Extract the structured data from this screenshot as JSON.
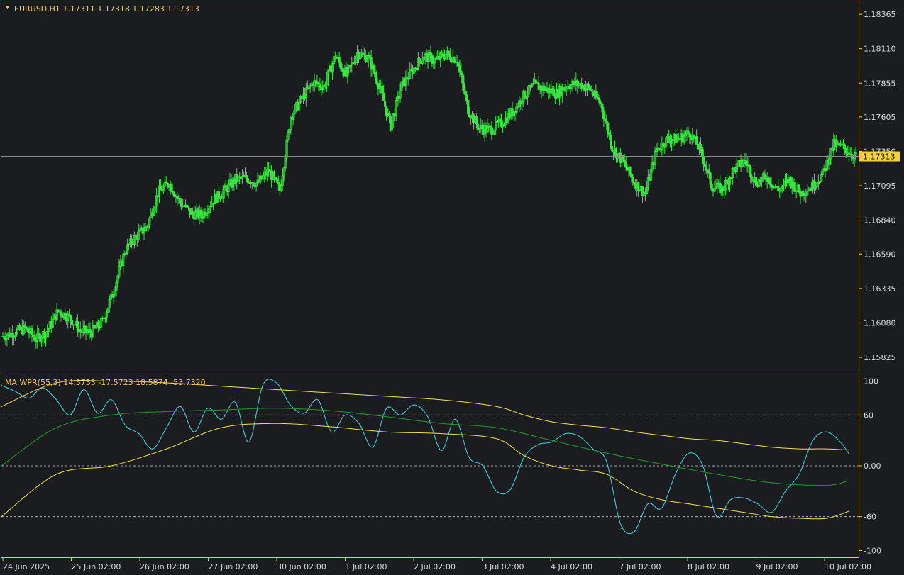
{
  "colors": {
    "background": "#1b1c20",
    "frame": "#f2c94c",
    "bull_candle": "#37e63f",
    "bear_candle": "#37e63f",
    "price_line": "#8a8a8a",
    "price_tag_bg": "#f2d13a",
    "wpr_line": "#3fd8e6",
    "band_line": "#f2e04a",
    "mid_line": "#1e9c2a",
    "text": "#d8d8d8",
    "header_text": "#f2c94c"
  },
  "chart_data": [
    {
      "type": "candlestick",
      "title": "EURUSD,H1  1.17311 1.17318 1.17283 1.17313",
      "symbol": "EURUSD,H1",
      "ohlc": {
        "open": 1.17311,
        "high": 1.17318,
        "low": 1.17283,
        "close": 1.17313
      },
      "current_price": 1.17313,
      "current_price_label": "1.17313",
      "ylim": [
        1.1572,
        1.1846
      ],
      "yticks": [
        1.18365,
        1.1811,
        1.17855,
        1.17605,
        1.1735,
        1.17095,
        1.1684,
        1.1659,
        1.16335,
        1.1608,
        1.15825
      ],
      "ytick_labels": [
        "1.18365",
        "1.18110",
        "1.17855",
        "1.17605",
        "1.17350",
        "1.17095",
        "1.16840",
        "1.16590",
        "1.16335",
        "1.16080",
        "1.15825"
      ],
      "xtick_labels": [
        "24 Jun 2025",
        "25 Jun 02:00",
        "26 Jun 02:00",
        "27 Jun 02:00",
        "30 Jun 02:00",
        "1 Jul 02:00",
        "2 Jul 02:00",
        "3 Jul 02:00",
        "4 Jul 02:00",
        "7 Jul 02:00",
        "8 Jul 02:00",
        "9 Jul 02:00",
        "10 Jul 02:00"
      ],
      "close_path": [
        [
          0,
          1.1598
        ],
        [
          8,
          1.1601
        ],
        [
          16,
          1.1604
        ],
        [
          24,
          1.1596
        ],
        [
          32,
          1.1602
        ],
        [
          40,
          1.1617
        ],
        [
          48,
          1.1612
        ],
        [
          56,
          1.1602
        ],
        [
          64,
          1.1601
        ],
        [
          72,
          1.1609
        ],
        [
          80,
          1.1632
        ],
        [
          88,
          1.1661
        ],
        [
          96,
          1.1672
        ],
        [
          104,
          1.1679
        ],
        [
          112,
          1.1704
        ],
        [
          120,
          1.1712
        ],
        [
          128,
          1.1697
        ],
        [
          136,
          1.1689
        ],
        [
          144,
          1.1688
        ],
        [
          152,
          1.1699
        ],
        [
          160,
          1.1706
        ],
        [
          168,
          1.1714
        ],
        [
          176,
          1.1715
        ],
        [
          184,
          1.1711
        ],
        [
          192,
          1.1721
        ],
        [
          200,
          1.1706
        ],
        [
          208,
          1.1761
        ],
        [
          216,
          1.1774
        ],
        [
          224,
          1.1786
        ],
        [
          232,
          1.1783
        ],
        [
          240,
          1.1806
        ],
        [
          248,
          1.1791
        ],
        [
          256,
          1.1808
        ],
        [
          264,
          1.1804
        ],
        [
          272,
          1.1783
        ],
        [
          280,
          1.1754
        ],
        [
          288,
          1.1784
        ],
        [
          296,
          1.1795
        ],
        [
          304,
          1.1806
        ],
        [
          312,
          1.1802
        ],
        [
          320,
          1.1807
        ],
        [
          328,
          1.1803
        ],
        [
          336,
          1.1766
        ],
        [
          344,
          1.1752
        ],
        [
          352,
          1.1751
        ],
        [
          360,
          1.1756
        ],
        [
          368,
          1.1764
        ],
        [
          376,
          1.1776
        ],
        [
          384,
          1.1784
        ],
        [
          392,
          1.1781
        ],
        [
          400,
          1.1778
        ],
        [
          408,
          1.1784
        ],
        [
          416,
          1.1785
        ],
        [
          424,
          1.1781
        ],
        [
          432,
          1.177
        ],
        [
          440,
          1.1738
        ],
        [
          448,
          1.1727
        ],
        [
          456,
          1.1712
        ],
        [
          464,
          1.1704
        ],
        [
          472,
          1.1736
        ],
        [
          480,
          1.1744
        ],
        [
          488,
          1.1744
        ],
        [
          496,
          1.1749
        ],
        [
          504,
          1.1735
        ],
        [
          512,
          1.1709
        ],
        [
          520,
          1.1707
        ],
        [
          528,
          1.1722
        ],
        [
          536,
          1.1728
        ],
        [
          544,
          1.1712
        ],
        [
          552,
          1.1716
        ],
        [
          560,
          1.1706
        ],
        [
          568,
          1.1714
        ],
        [
          576,
          1.1704
        ],
        [
          584,
          1.1709
        ],
        [
          592,
          1.1718
        ],
        [
          600,
          1.174
        ],
        [
          608,
          1.1737
        ],
        [
          616,
          1.1731
        ]
      ]
    },
    {
      "type": "line",
      "title": "MA  WPR(55,3) 14.5733 -17.5723 18.5874 -53.7320",
      "indicator": "WPR(55,3)",
      "values": [
        14.5733,
        -17.5723,
        18.5874,
        -53.732
      ],
      "ylim": [
        -108,
        108
      ],
      "yticks": [
        100,
        60,
        0,
        -60,
        -100
      ],
      "ytick_labels": [
        "100",
        "60",
        "0.00",
        "-60",
        "-100"
      ],
      "levels": [
        60,
        0,
        -60
      ],
      "series": [
        {
          "name": "WPR",
          "x": [
            0,
            10,
            20,
            30,
            40,
            50,
            60,
            70,
            80,
            90,
            100,
            110,
            120,
            130,
            140,
            150,
            160,
            170,
            180,
            190,
            200,
            210,
            220,
            230,
            240,
            250,
            260,
            270,
            280,
            290,
            300,
            310,
            320,
            330,
            340,
            350,
            360,
            370,
            380,
            390,
            400,
            410,
            420,
            430,
            440,
            450,
            460,
            470,
            480,
            490,
            500,
            510,
            520,
            530,
            540,
            550,
            560,
            570,
            580,
            590,
            600,
            610,
            616
          ],
          "y": [
            95,
            88,
            80,
            92,
            78,
            60,
            90,
            62,
            78,
            48,
            38,
            20,
            45,
            70,
            40,
            68,
            55,
            75,
            28,
            95,
            98,
            72,
            62,
            78,
            40,
            60,
            50,
            22,
            68,
            60,
            72,
            58,
            18,
            55,
            10,
            0,
            -30,
            -28,
            10,
            25,
            28,
            38,
            35,
            20,
            5,
            -68,
            -78,
            -45,
            -50,
            -10,
            15,
            0,
            -60,
            -40,
            -38,
            -45,
            -55,
            -30,
            -10,
            30,
            40,
            28,
            14.6
          ]
        },
        {
          "name": "Upper band",
          "x": [
            0,
            40,
            80,
            120,
            160,
            200,
            240,
            280,
            320,
            360,
            380,
            400,
            420,
            440,
            460,
            480,
            500,
            520,
            540,
            560,
            580,
            600,
            616
          ],
          "y": [
            70,
            98,
            100,
            98,
            94,
            90,
            86,
            82,
            78,
            70,
            60,
            52,
            48,
            45,
            40,
            36,
            32,
            30,
            26,
            22,
            20,
            20,
            18.6
          ]
        },
        {
          "name": "Middle line",
          "x": [
            0,
            40,
            80,
            120,
            160,
            200,
            240,
            280,
            320,
            360,
            400,
            440,
            480,
            520,
            560,
            600,
            616
          ],
          "y": [
            0,
            45,
            60,
            64,
            66,
            68,
            65,
            58,
            50,
            45,
            30,
            15,
            2,
            -10,
            -20,
            -23,
            -17.6
          ]
        },
        {
          "name": "Lower band",
          "x": [
            0,
            40,
            80,
            120,
            160,
            200,
            240,
            280,
            320,
            360,
            380,
            400,
            420,
            440,
            460,
            480,
            500,
            520,
            540,
            560,
            580,
            600,
            616
          ],
          "y": [
            -60,
            -10,
            0,
            20,
            45,
            50,
            46,
            40,
            38,
            32,
            12,
            0,
            -5,
            -10,
            -30,
            -40,
            -45,
            -50,
            -55,
            -60,
            -62,
            -62,
            -53.7
          ]
        }
      ]
    }
  ]
}
